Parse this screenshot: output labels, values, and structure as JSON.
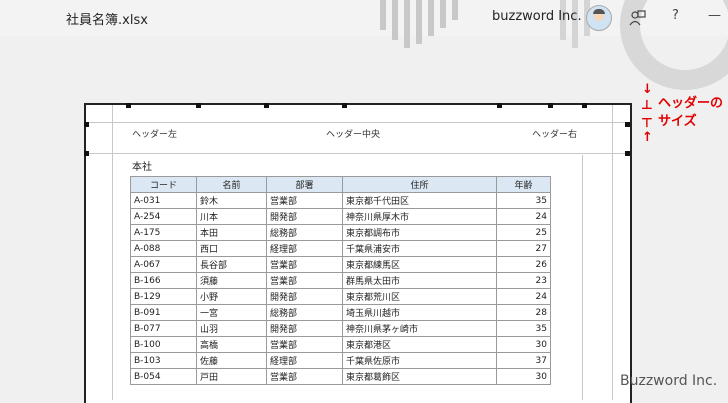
{
  "titlebar": {
    "title": "社員名簿.xlsx",
    "account": "buzzword Inc.",
    "icons": [
      "person-feedback-icon",
      "help-icon",
      "minimize-icon"
    ],
    "help": "?",
    "minimize": "—"
  },
  "header": {
    "left": "ヘッダー左",
    "center": "ヘッダー中央",
    "right": "ヘッダー右"
  },
  "section_label": "本社",
  "table": {
    "columns": [
      "コード",
      "名前",
      "部署",
      "住所",
      "年齢"
    ],
    "rows": [
      [
        "A-031",
        "鈴木",
        "営業部",
        "東京都千代田区",
        "35"
      ],
      [
        "A-254",
        "川本",
        "開発部",
        "神奈川県厚木市",
        "24"
      ],
      [
        "A-175",
        "本田",
        "総務部",
        "東京都調布市",
        "25"
      ],
      [
        "A-088",
        "西口",
        "経理部",
        "千葉県浦安市",
        "27"
      ],
      [
        "A-067",
        "長谷部",
        "営業部",
        "東京都練馬区",
        "26"
      ],
      [
        "B-166",
        "須藤",
        "営業部",
        "群馬県太田市",
        "23"
      ],
      [
        "B-129",
        "小野",
        "開発部",
        "東京都荒川区",
        "24"
      ],
      [
        "B-091",
        "一宮",
        "総務部",
        "埼玉県川越市",
        "28"
      ],
      [
        "B-077",
        "山羽",
        "開発部",
        "神奈川県茅ヶ崎市",
        "35"
      ],
      [
        "B-100",
        "高橋",
        "営業部",
        "東京都港区",
        "30"
      ],
      [
        "B-103",
        "佐藤",
        "経理部",
        "千葉県佐原市",
        "37"
      ],
      [
        "B-054",
        "戸田",
        "営業部",
        "東京都葛飾区",
        "30"
      ]
    ]
  },
  "annotation": {
    "line1": "ヘッダーの",
    "line2": "サイズ",
    "color": "#e00000"
  },
  "watermark": "Buzzword Inc."
}
